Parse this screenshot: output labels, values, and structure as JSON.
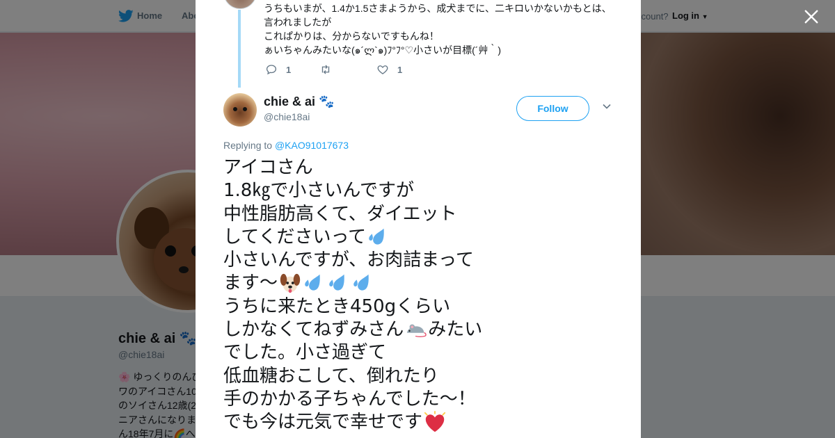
{
  "nav": {
    "home_label": "Home",
    "about_label": "Abo",
    "have_account": "ccount?",
    "login_label": "Log in"
  },
  "background_profile": {
    "name": "chie & ai",
    "handle": "@chie18ai",
    "bio_lines": [
      "🌸 ゆっくりのんび",
      "ワのアイコさん10",
      "のソイさん12歳(2",
      "ニアさんになりま",
      "ん18年7月に🌈へ"
    ]
  },
  "previous_tweet": {
    "lines": [
      "うちもいまが、1.4か1.5さまようから、成犬までに、二キロいかないかもとは、",
      "言われましたが",
      "これぱかりは、分からないですもんね！",
      "ぁいちゃんみたいな(๑´ლ`๑)ﾌ°ﾌ°♡小さいが目標(´艸｀)"
    ],
    "reply_count": "1",
    "retweet_count": "",
    "like_count": "1"
  },
  "tweet": {
    "author_name": "chie & ai",
    "author_handle": "@chie18ai",
    "follow_label": "Follow",
    "replying_prefix": "Replying to",
    "replying_to": "@KAO91017673",
    "text_lines": [
      "アイコさん",
      "1.8㎏で小さいんですが",
      "中性脂肪高くて、ダイエット",
      "してくださいって",
      "小さいんですが、お肉詰まって",
      "ます〜",
      "うちに来たとき450gくらい",
      "しかなくてねずみさん",
      "みたい",
      "でした。小さ過ぎて",
      "低血糖おこして、倒れたり",
      "手のかかる子ちゃんでした〜！",
      "でも今は元気で幸せです"
    ]
  },
  "colors": {
    "twitter_blue": "#1da1f2",
    "thread_line": "#a4d9f7",
    "text_secondary": "#657786"
  },
  "icons": [
    "twitter-bird-icon",
    "close-icon",
    "reply-icon",
    "retweet-icon",
    "heart-icon",
    "chevron-down-icon",
    "paw-icon",
    "sweat-drops-icon",
    "dog-face-icon",
    "mouse-icon",
    "sparkling-heart-icon"
  ]
}
